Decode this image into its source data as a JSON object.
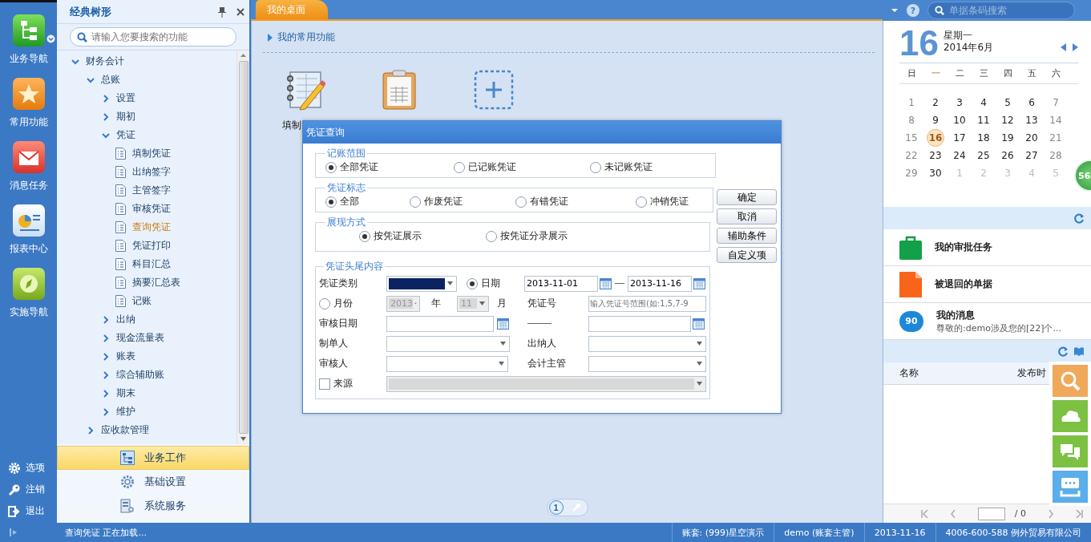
{
  "nav": {
    "items": [
      {
        "label": "业务导航",
        "kind": "tree",
        "has_menu": true
      },
      {
        "label": "常用功能",
        "kind": "star",
        "has_menu": false
      },
      {
        "label": "消息任务",
        "kind": "mail",
        "has_menu": false
      },
      {
        "label": "报表中心",
        "kind": "report",
        "has_menu": false
      },
      {
        "label": "实施导航",
        "kind": "compass",
        "has_menu": false
      }
    ],
    "bottom": [
      {
        "label": "选项",
        "kind": "gear"
      },
      {
        "label": "注销",
        "kind": "key"
      },
      {
        "label": "退出",
        "kind": "exit"
      }
    ]
  },
  "tree_panel": {
    "title": "经典树形",
    "search": {
      "placeholder": "请输入您要搜索的功能"
    },
    "tree": [
      {
        "label": "财务会计",
        "expanded": true,
        "children": [
          {
            "label": "总账",
            "expanded": true,
            "children": [
              {
                "label": "设置",
                "expanded": false
              },
              {
                "label": "期初",
                "expanded": false
              },
              {
                "label": "凭证",
                "expanded": true,
                "children": [
                  {
                    "label": "填制凭证",
                    "selected": false
                  },
                  {
                    "label": "出纳签字",
                    "selected": false
                  },
                  {
                    "label": "主管签字",
                    "selected": false
                  },
                  {
                    "label": "审核凭证",
                    "selected": false
                  },
                  {
                    "label": "查询凭证",
                    "selected": true
                  },
                  {
                    "label": "凭证打印",
                    "selected": false
                  },
                  {
                    "label": "科目汇总",
                    "selected": false
                  },
                  {
                    "label": "摘要汇总表",
                    "selected": false
                  },
                  {
                    "label": "记账",
                    "selected": false
                  }
                ]
              },
              {
                "label": "出纳",
                "expanded": false
              },
              {
                "label": "现金流量表",
                "expanded": false
              },
              {
                "label": "账表",
                "expanded": false
              },
              {
                "label": "综合辅助账",
                "expanded": false
              },
              {
                "label": "期末",
                "expanded": false
              },
              {
                "label": "维护",
                "expanded": false
              }
            ]
          },
          {
            "label": "应收款管理",
            "expanded": false
          }
        ]
      }
    ],
    "modules": [
      {
        "label": "业务工作",
        "kind": "work",
        "selected": true
      },
      {
        "label": "基础设置",
        "kind": "gear",
        "selected": false
      },
      {
        "label": "系统服务",
        "kind": "server",
        "selected": false
      }
    ]
  },
  "main": {
    "tabs": [
      {
        "label": "我的桌面",
        "selected": true
      }
    ],
    "section_title": "我的常用功能",
    "shortcuts": [
      {
        "kind": "notebook",
        "label": "填制"
      },
      {
        "kind": "clipboard"
      },
      {
        "kind": "add"
      }
    ],
    "pager": [
      {
        "label": "1",
        "selected": true
      }
    ]
  },
  "dialog": {
    "title": "凭证查询",
    "groups": [
      {
        "legend": "记账范围",
        "options": [
          {
            "label": "全部凭证",
            "selected": true
          },
          {
            "label": "已记账凭证",
            "selected": false
          },
          {
            "label": "未记账凭证",
            "selected": false
          }
        ]
      },
      {
        "legend": "凭证标志",
        "options": [
          {
            "label": "全部",
            "selected": true
          },
          {
            "label": "作废凭证",
            "selected": false
          },
          {
            "label": "有错凭证",
            "selected": false
          },
          {
            "label": "冲销凭证",
            "selected": false
          }
        ]
      },
      {
        "legend": "展现方式",
        "options": [
          {
            "label": "按凭证展示",
            "selected": true
          },
          {
            "label": "按凭证分录展示",
            "selected": false
          }
        ]
      }
    ],
    "header": {
      "legend": "凭证头尾内容",
      "voucher_type_label": "凭证类别",
      "date_option": {
        "label": "日期",
        "selected": true
      },
      "date_from": "2013-11-01",
      "date_to": "2013-11-16",
      "month_option": {
        "label": "月份",
        "selected": false
      },
      "year": {
        "value": "2013",
        "disabled": true
      },
      "year_unit": "年",
      "month": {
        "value": "11",
        "disabled": true
      },
      "month_unit": "月",
      "voucher_no_label": "凭证号",
      "voucher_no": {
        "placeholder": "输入凭证号范围(如:1,5,7-9"
      },
      "audit_date_label": "审核日期",
      "maker_label": "制单人",
      "cashier_label": "出纳人",
      "auditor_label": "审核人",
      "supervisor_label": "会计主管",
      "source": {
        "label": "来源",
        "checked": false
      }
    },
    "buttons": [
      "确定",
      "取消",
      "辅助条件",
      "自定义项"
    ]
  },
  "right": {
    "help": "?",
    "search": {
      "placeholder": "单据条码搜索"
    },
    "calendar": {
      "day": "16",
      "weekday": "星期一",
      "month": "2014年6月",
      "weekdays": [
        {
          "label": "日",
          "selected": false
        },
        {
          "label": "一",
          "selected": true
        },
        {
          "label": "二",
          "selected": false
        },
        {
          "label": "三",
          "selected": false
        },
        {
          "label": "四",
          "selected": false
        },
        {
          "label": "五",
          "selected": false
        },
        {
          "label": "六",
          "selected": false
        }
      ],
      "weeks": [
        [
          {
            "label": "1",
            "kind": "weekend",
            "selected": false
          },
          {
            "label": "2",
            "kind": "weekday",
            "selected": false
          },
          {
            "label": "3",
            "kind": "weekday",
            "selected": false
          },
          {
            "label": "4",
            "kind": "weekday",
            "selected": false
          },
          {
            "label": "5",
            "kind": "weekday",
            "selected": false
          },
          {
            "label": "6",
            "kind": "weekday",
            "selected": false
          },
          {
            "label": "7",
            "kind": "weekend",
            "selected": false
          }
        ],
        [
          {
            "label": "8",
            "kind": "weekend",
            "selected": false
          },
          {
            "label": "9",
            "kind": "weekday",
            "selected": false
          },
          {
            "label": "10",
            "kind": "weekday",
            "selected": false
          },
          {
            "label": "11",
            "kind": "weekday",
            "selected": false
          },
          {
            "label": "12",
            "kind": "weekday",
            "selected": false
          },
          {
            "label": "13",
            "kind": "weekday",
            "selected": false
          },
          {
            "label": "14",
            "kind": "weekend",
            "selected": false
          }
        ],
        [
          {
            "label": "15",
            "kind": "weekend",
            "selected": false
          },
          {
            "label": "16",
            "kind": "weekday",
            "selected": true
          },
          {
            "label": "17",
            "kind": "weekday",
            "selected": false
          },
          {
            "label": "18",
            "kind": "weekday",
            "selected": false
          },
          {
            "label": "19",
            "kind": "weekday",
            "selected": false
          },
          {
            "label": "20",
            "kind": "weekday",
            "selected": false
          },
          {
            "label": "21",
            "kind": "weekend",
            "selected": false
          }
        ],
        [
          {
            "label": "22",
            "kind": "weekend",
            "selected": false
          },
          {
            "label": "23",
            "kind": "weekday",
            "selected": false
          },
          {
            "label": "24",
            "kind": "weekday",
            "selected": false
          },
          {
            "label": "25",
            "kind": "weekday",
            "selected": false
          },
          {
            "label": "26",
            "kind": "weekday",
            "selected": false
          },
          {
            "label": "27",
            "kind": "weekday",
            "selected": false
          },
          {
            "label": "28",
            "kind": "weekend",
            "selected": false
          }
        ],
        [
          {
            "label": "29",
            "kind": "weekend",
            "selected": false
          },
          {
            "label": "30",
            "kind": "weekday",
            "selected": false
          },
          {
            "label": "1",
            "kind": "other",
            "selected": false
          },
          {
            "label": "2",
            "kind": "other",
            "selected": false
          },
          {
            "label": "3",
            "kind": "other",
            "selected": false
          },
          {
            "label": "4",
            "kind": "other",
            "selected": false
          },
          {
            "label": "5",
            "kind": "other",
            "selected": false
          }
        ]
      ]
    },
    "tasks": [
      {
        "kind": "briefcase",
        "title": "我的审批任务"
      },
      {
        "kind": "document",
        "title": "被退回的单据"
      },
      {
        "kind": "message",
        "title": "我的消息",
        "badge": "90",
        "subtitle": "尊敬的:demo涉及您的[22]个..."
      }
    ],
    "table": {
      "columns": [
        "名称",
        "发布时"
      ]
    },
    "pager": {
      "total": "/ 0"
    },
    "float_badge": "56",
    "float_tools": [
      {
        "kind": "search",
        "color": "#f0a85a"
      },
      {
        "kind": "cloud",
        "color": "#7cc142"
      },
      {
        "kind": "chat",
        "color": "#7cc142"
      },
      {
        "kind": "inbox",
        "color": "#5aaeea"
      }
    ]
  },
  "status_bar": {
    "message": "查询凭证 正在加载...",
    "segments": [
      "账套: (999)星空演示",
      "demo (账套主管)",
      "2013-11-16",
      "4006-600-588 例外贸易有限公司"
    ]
  }
}
